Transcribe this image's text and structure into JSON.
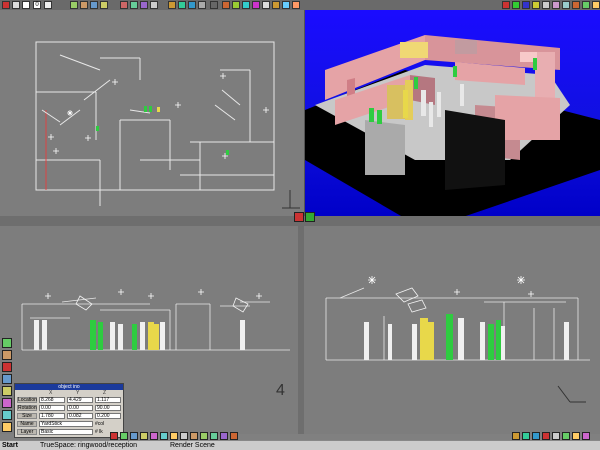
{
  "window": {
    "zoom_value": "0"
  },
  "status_bar": {
    "start_label": "Start",
    "task_label": "TrueSpace: ringwood/reception",
    "render_label": "Render Scene"
  },
  "properties_panel": {
    "title": "object ino",
    "col_headers": [
      "X",
      "Y",
      "Z"
    ],
    "rows": [
      {
        "label": "Location",
        "values": [
          "8.268",
          "4.429",
          "1.117"
        ]
      },
      {
        "label": "Rotation",
        "values": [
          "0.00",
          "0.00",
          "90.00"
        ]
      },
      {
        "label": "Size",
        "values": [
          "1.780",
          "0.082",
          "0.200"
        ]
      }
    ],
    "name_label": "Name",
    "name_value": "YardStick",
    "layer_label": "Layer",
    "layer_value": "Basic",
    "col_option": "#col",
    "lock_option": "# lk"
  },
  "axes_marker": "4",
  "colors": {
    "background": "#808080",
    "viewport": "#7d7d7d",
    "sky": "#1a0cff",
    "wall": "#e5a3a6",
    "figure_green": "#2ecc40",
    "figure_yellow": "#e8d84a",
    "figure_white": "#f0f0f0",
    "titlebar": "#1b3a9c"
  }
}
